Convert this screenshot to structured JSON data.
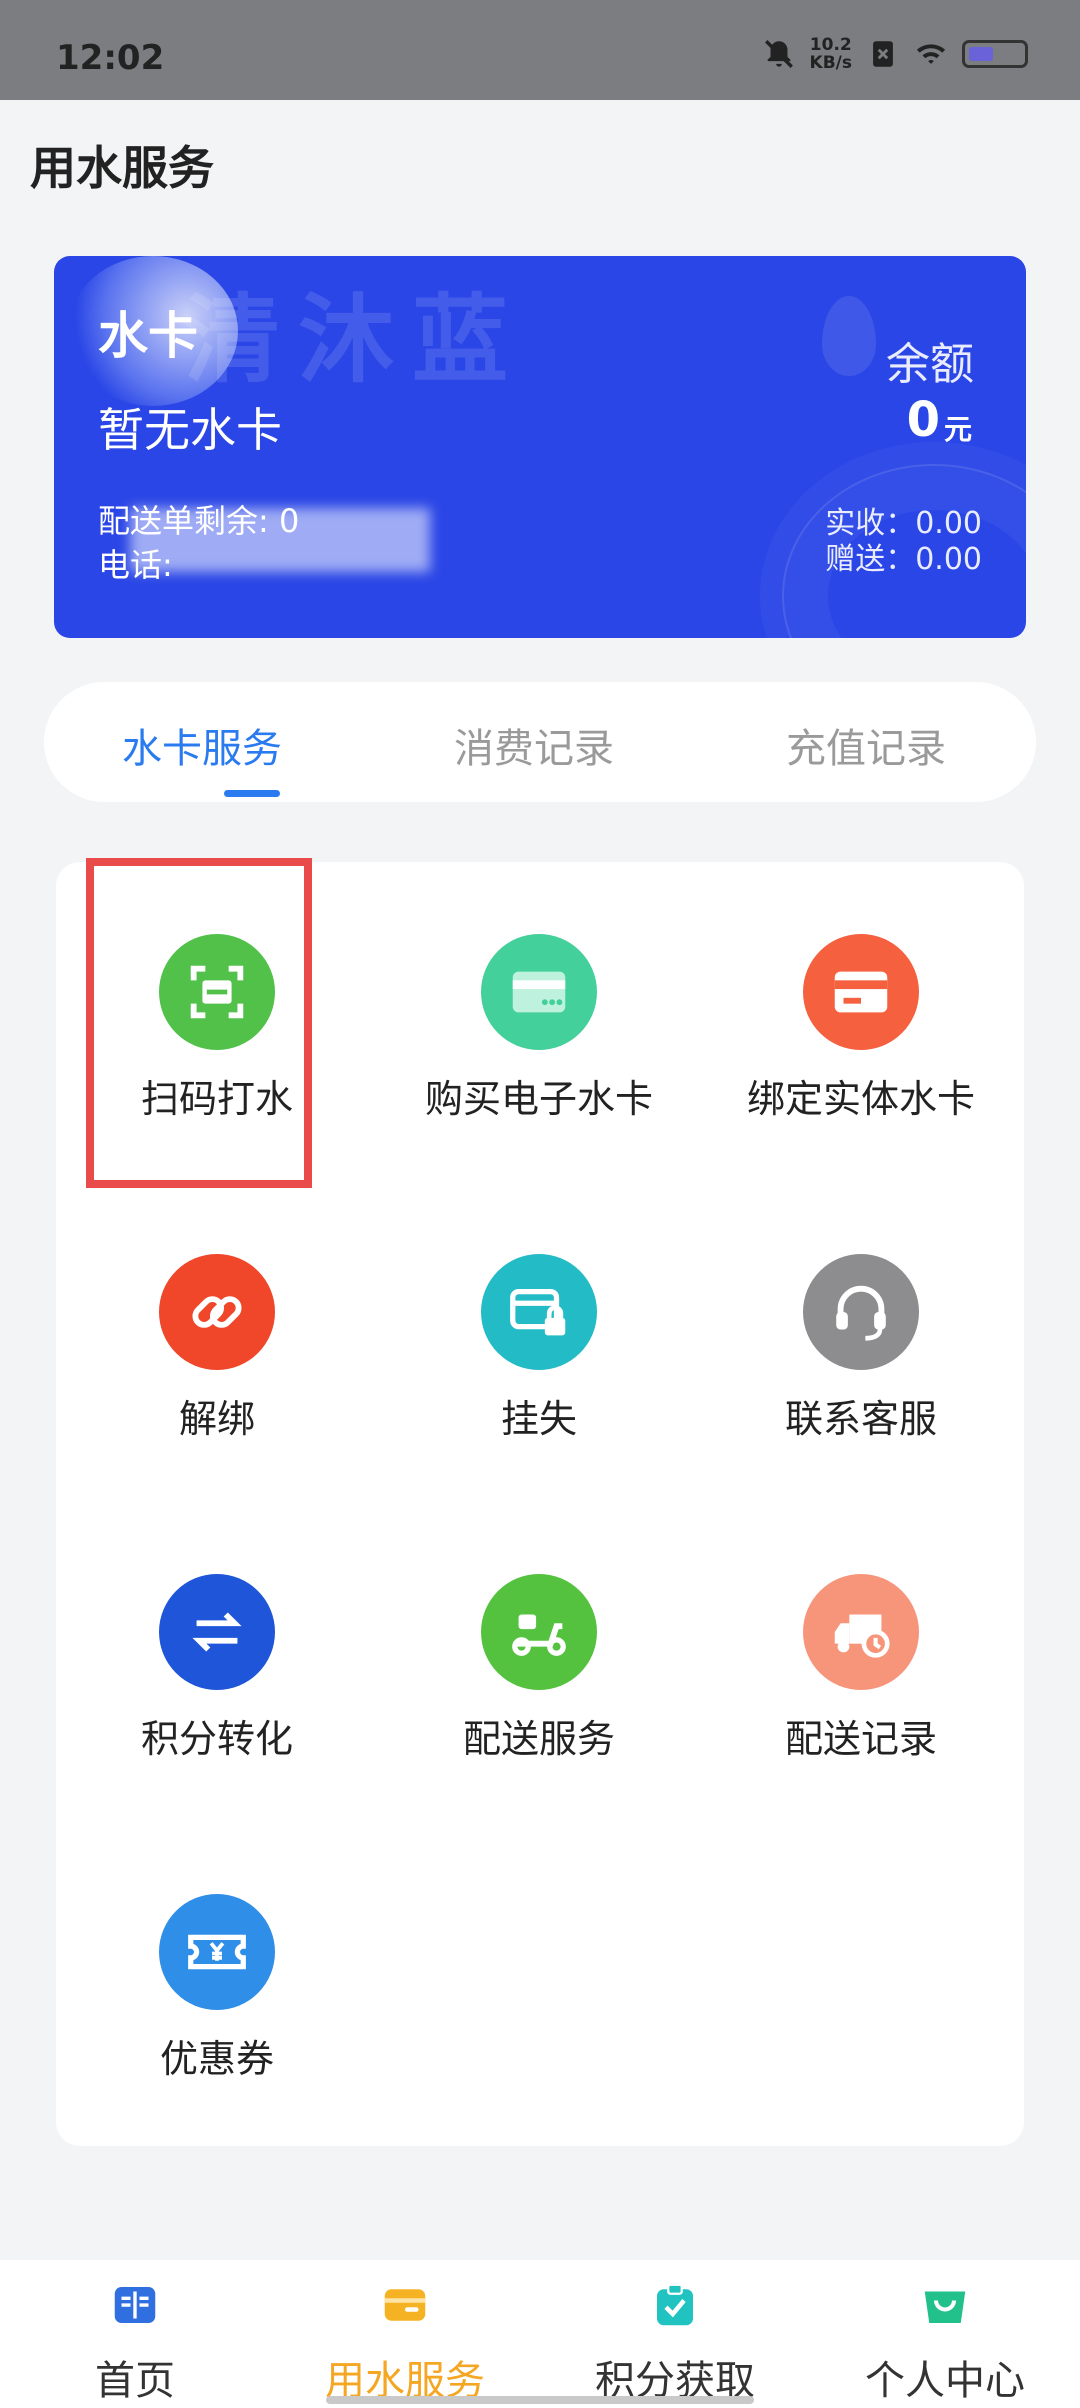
{
  "status_bar": {
    "time": "12:02",
    "speed_value": "10.2",
    "speed_unit": "KB/s",
    "battery_level": 0.4
  },
  "header": {
    "title": "用水服务"
  },
  "card": {
    "label": "水卡",
    "status": "暂无水卡",
    "delivery": "配送单剩余: 0",
    "phone": "电话:",
    "balance_label": "余额",
    "balance_value": "0",
    "balance_unit": "元",
    "received": "实收：0.00",
    "gift": "赠送：0.00",
    "watermark": "清沐蓝",
    "colors": {
      "background": "#2a46e6"
    }
  },
  "tabs": [
    {
      "label": "水卡服务",
      "active": true
    },
    {
      "label": "消费记录",
      "active": false
    },
    {
      "label": "充值记录",
      "active": false
    }
  ],
  "services": [
    {
      "label": "扫码打水",
      "icon": "scan-icon",
      "color": "#52c14a"
    },
    {
      "label": "购买电子水卡",
      "icon": "card-icon",
      "color": "#43d09a"
    },
    {
      "label": "绑定实体水卡",
      "icon": "bind-card-icon",
      "color": "#f5603f"
    },
    {
      "label": "解绑",
      "icon": "unlink-icon",
      "color": "#f0462a"
    },
    {
      "label": "挂失",
      "icon": "lock-card-icon",
      "color": "#23bcc6"
    },
    {
      "label": "联系客服",
      "icon": "headset-icon",
      "color": "#8d8d8f"
    },
    {
      "label": "积分转化",
      "icon": "swap-icon",
      "color": "#1f56d9"
    },
    {
      "label": "配送服务",
      "icon": "scooter-icon",
      "color": "#55c23f"
    },
    {
      "label": "配送记录",
      "icon": "truck-clock-icon",
      "color": "#f7957b"
    },
    {
      "label": "优惠券",
      "icon": "coupon-icon",
      "color": "#2f8ee8"
    }
  ],
  "bottom_nav": [
    {
      "label": "首页",
      "icon": "book-icon",
      "color": "#2f6fe0",
      "active": false
    },
    {
      "label": "用水服务",
      "icon": "wallet-icon",
      "color": "#f5b323",
      "active": true
    },
    {
      "label": "积分获取",
      "icon": "clipboard-check-icon",
      "color": "#20c3c0",
      "active": false
    },
    {
      "label": "个人中心",
      "icon": "basket-icon",
      "color": "#22c08a",
      "active": false
    }
  ]
}
